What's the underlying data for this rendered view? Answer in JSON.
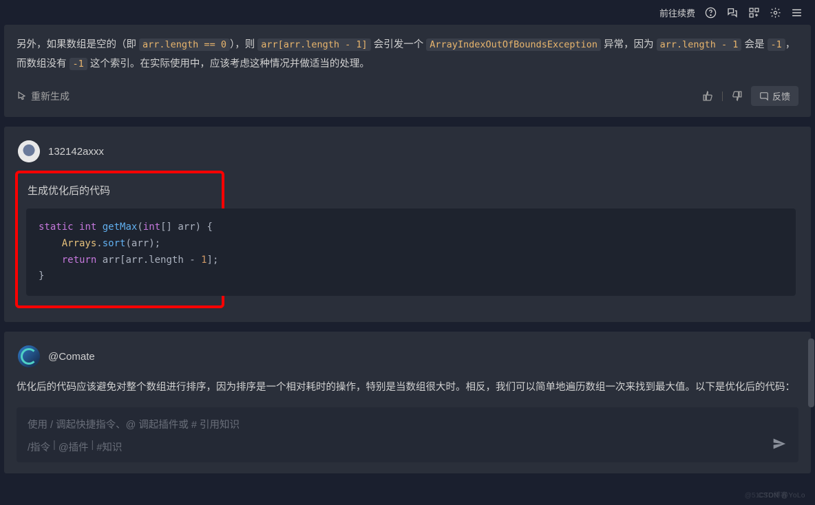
{
  "topbar": {
    "renew_label": "前往续费"
  },
  "assistant_msg": {
    "text_1": "另外，如果数组是空的（即 ",
    "code_1": "arr.length == 0",
    "text_2": "），则 ",
    "code_2": "arr[arr.length - 1]",
    "text_3": " 会引发一个 ",
    "code_3": "ArrayIndexOutOfBoundsException",
    "text_4": " 异常，因为 ",
    "code_4": "arr.length - 1",
    "text_5": " 会是 ",
    "code_5": "-1",
    "text_6": "，而数组没有 ",
    "code_6": "-1",
    "text_7": " 这个索引。在实际使用中，应该考虑这种情况并做适当的处理。"
  },
  "actions": {
    "regenerate": "重新生成",
    "feedback": "反馈"
  },
  "user": {
    "name": "132142axxx",
    "prompt_title": "生成优化后的代码",
    "code": {
      "kw_static": "static",
      "kw_int": "int",
      "fn": "getMax",
      "param_type": "int",
      "param_name": "arr",
      "cls": "Arrays",
      "method": "sort",
      "kw_return": "return",
      "prop": "length",
      "one": "1"
    }
  },
  "comate": {
    "name": "@Comate",
    "reply": "优化后的代码应该避免对整个数组进行排序，因为排序是一个相对耗时的操作，特别是当数组很大时。相反，我们可以简单地遍历数组一次来找到最大值。以下是优化后的代码："
  },
  "input": {
    "placeholder": "使用 / 调起快捷指令、@ 调起插件或 # 引用知识",
    "hint_cmd": "/指令",
    "hint_plugin": "@插件",
    "hint_knowledge": "#知识"
  },
  "watermark": "CSDN @YoLo",
  "watermark2": "@51CTO博客"
}
